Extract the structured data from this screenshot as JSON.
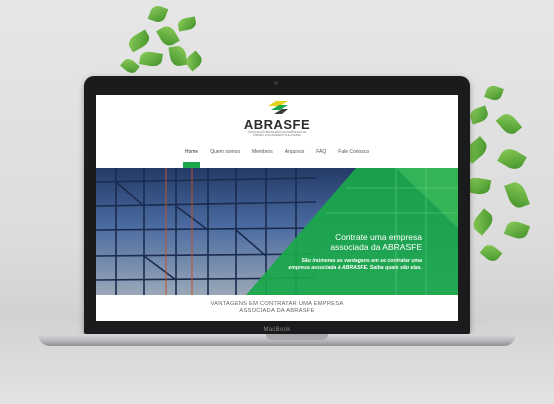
{
  "site": {
    "logo_title": "ABRASFE",
    "logo_subtitle": "ASSOCIAÇÃO BRASILEIRA DAS EMPRESAS DE FÔRMAS, ESCORAMENTOS E ACESSO",
    "nav": [
      "Home",
      "Quem somos",
      "Membros",
      "Arquivos",
      "FAQ",
      "Fale Conosco"
    ],
    "active_nav": "Home",
    "hero": {
      "title_line1": "Contrate uma empresa",
      "title_line2": "associada da ABRASFE",
      "text_line1": "São inúmeras as vantagens em se contratar uma",
      "text_line2": "empresa associada à ABRASFE. Saiba quais são elas."
    },
    "section_title_line1": "VANTAGENS EM CONTRATAR UMA EMPRESA",
    "section_title_line2": "ASSOCIADA DA ABRASFE"
  },
  "device": {
    "label": "MacBook"
  },
  "colors": {
    "brand_green": "#1aa84a",
    "logo_yellow": "#e3d21c",
    "bezel": "#1b1b1d"
  }
}
